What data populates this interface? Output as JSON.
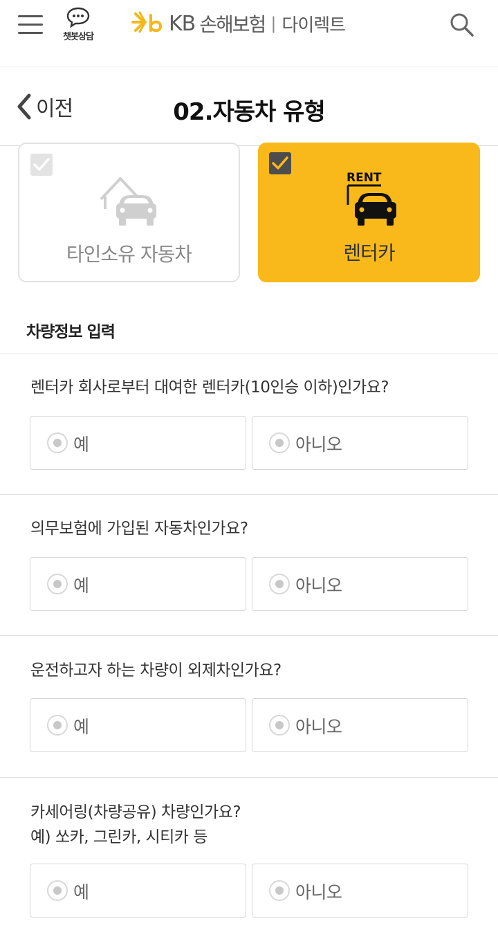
{
  "header": {
    "chatbot_label": "챗봇상담",
    "logo_kb": "KB",
    "logo_brand": "손해보험",
    "logo_separator": "|",
    "logo_direct": "다이렉트"
  },
  "subheader": {
    "back_label": "이전",
    "title": "02.자동차 유형"
  },
  "vehicle_types": [
    {
      "label": "타인소유 자동차",
      "selected": false
    },
    {
      "label": "렌터카",
      "selected": true,
      "icon_text": "RENT"
    }
  ],
  "section": {
    "title": "차량정보 입력"
  },
  "questions": [
    {
      "text": "렌터카 회사로부터 대여한 렌터카(10인승 이하)인가요?",
      "yes": "예",
      "no": "아니오"
    },
    {
      "text": "의무보험에 가입된 자동차인가요?",
      "yes": "예",
      "no": "아니오"
    },
    {
      "text": "운전하고자 하는 차량이 외제차인가요?",
      "yes": "예",
      "no": "아니오"
    },
    {
      "text": "카세어링(차량공유) 차량인가요?",
      "text_line2": "예) 쏘카, 그린카, 시티카 등",
      "yes": "예",
      "no": "아니오"
    }
  ],
  "colors": {
    "accent": "#f9b91a",
    "logo_yellow": "#f5b719"
  }
}
